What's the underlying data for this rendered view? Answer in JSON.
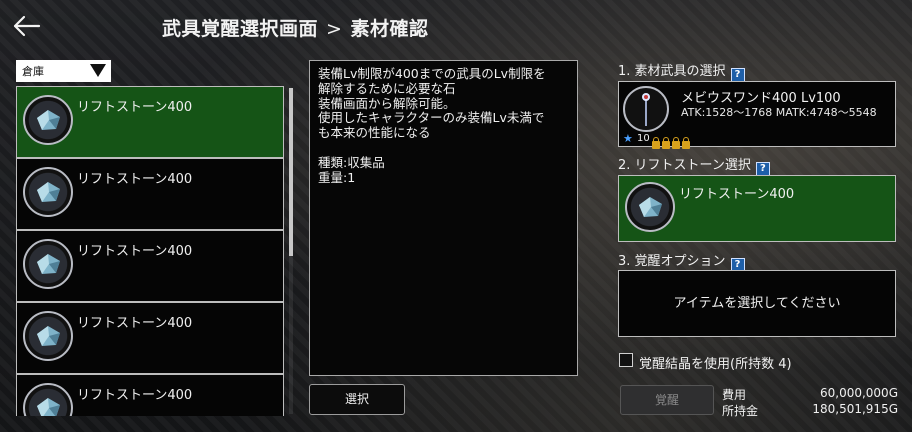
{
  "header": {
    "title": "武具覚醒選択画面",
    "separator": ">",
    "subtitle": "素材確認"
  },
  "storage_select": {
    "value": "倉庫"
  },
  "items": [
    {
      "name": "リフトストーン400",
      "selected": true
    },
    {
      "name": "リフトストーン400",
      "selected": false
    },
    {
      "name": "リフトストーン400",
      "selected": false
    },
    {
      "name": "リフトストーン400",
      "selected": false
    },
    {
      "name": "リフトストーン400",
      "selected": false
    }
  ],
  "description": {
    "lines": [
      "装備Lv制限が400までの武具のLv制限を",
      "解除するために必要な石",
      "装備画面から解除可能。",
      "使用したキャラクターのみ装備Lv未満で",
      "も本来の性能になる"
    ],
    "type": "種類:収集品",
    "weight": "重量:1"
  },
  "select_button": "選択",
  "right": {
    "section1": "1. 素材武具の選択",
    "section2": "2. リフトストーン選択",
    "section3": "3. 覚醒オプション",
    "help_glyph": "?",
    "weapon": {
      "name": "メビウスワンド400  Lv100",
      "stats": "ATK:1528～1768  MATK:4748～5548",
      "star_count": "10"
    },
    "stone_name": "リフトストーン400",
    "option_placeholder": "アイテムを選択してください",
    "crystal_label": "覚醒結晶を使用(所持数 4)",
    "awaken_button": "覚醒",
    "cost_label": "費用",
    "cost_value": "60,000,000G",
    "money_label": "所持金",
    "money_value": "180,501,915G"
  }
}
